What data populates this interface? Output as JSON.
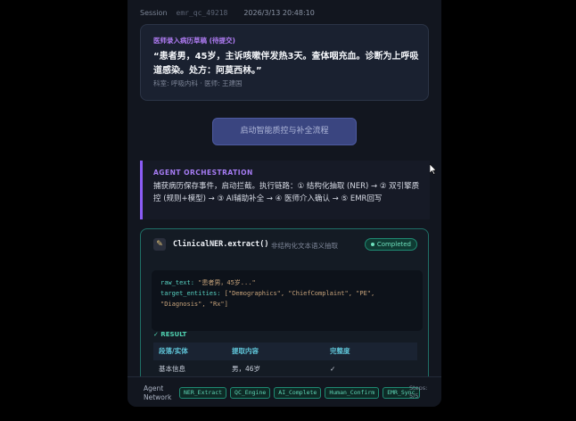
{
  "session": {
    "label": "Session",
    "id": "emr_qc_49218",
    "timestamp": "2026/3/13 20:48:10"
  },
  "emr": {
    "tag": "医师录入病历草稿 (待提交)",
    "text": "“患者男，45岁，主诉咳嗽伴发热3天。查体咽充血。诊断为上呼吸道感染。处方：阿莫西林。”",
    "meta": "科室: 呼吸内科 · 医师: 王建国"
  },
  "start_button": "启动智能质控与补全流程",
  "orchestration": {
    "title": "AGENT ORCHESTRATION",
    "desc": "捕获病历保存事件，启动拦截。执行链路：① 结构化抽取 (NER) → ② 双引擎质控 (规则+模型) → ③ AI辅助补全 → ④ 医师介入确认 → ⑤ EMR回写"
  },
  "ner": {
    "icon": "notepad-icon",
    "function": "ClinicalNER.extract()",
    "description": "非结构化文本语义抽取",
    "status": "Completed",
    "code_line1_key": "raw_text:",
    "code_line1_val": "\"患者男，45岁...\"",
    "code_line2_key": "target_entities:",
    "code_line2_val": "[\"Demographics\", \"ChiefComplaint\", \"PE\", \"Diagnosis\", \"Rx\"]",
    "result_label": "✓ RESULT",
    "columns": [
      "段落/实体",
      "提取内容",
      "完整度"
    ],
    "rows": [
      {
        "entity": "基本信息",
        "content": "男，46岁",
        "completeness": "✓"
      }
    ]
  },
  "bottom": {
    "label_line1": "Agent",
    "label_line2": "Network",
    "chips": [
      "NER_Extract",
      "QC_Engine",
      "AI_Complete",
      "Human_Confirm",
      "EMR_Sync"
    ],
    "steps_line1": "Steps:",
    "steps_line2": "5/5"
  },
  "colors": {
    "accent_purple": "#8b5cf6",
    "accent_teal": "#1f8a72",
    "panel_bg": "#12161f"
  }
}
